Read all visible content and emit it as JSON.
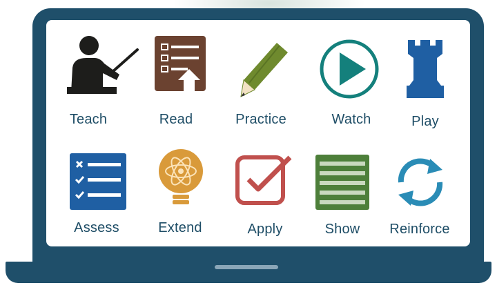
{
  "items": [
    {
      "label": "Teach",
      "icon": "teacher-icon"
    },
    {
      "label": "Read",
      "icon": "reading-list-icon"
    },
    {
      "label": "Practice",
      "icon": "pencil-icon"
    },
    {
      "label": "Watch",
      "icon": "play-icon"
    },
    {
      "label": "Play",
      "icon": "chess-rook-icon"
    },
    {
      "label": "Assess",
      "icon": "checklist-icon"
    },
    {
      "label": "Extend",
      "icon": "lightbulb-atom-icon"
    },
    {
      "label": "Apply",
      "icon": "checkbox-icon"
    },
    {
      "label": "Show",
      "icon": "document-lines-icon"
    },
    {
      "label": "Reinforce",
      "icon": "refresh-icon"
    }
  ],
  "colors": {
    "frame": "#1f4f6a",
    "label": "#1e4d66",
    "teach": "#1d1d1b",
    "read": "#6b4230",
    "practice": "#6f8a2e",
    "watch": "#14807c",
    "play": "#1f5fa3",
    "assess": "#1f5fa3",
    "extend": "#d99a3a",
    "apply": "#c0504d",
    "show": "#4d7f3a",
    "reinforce": "#2a8cb6"
  }
}
